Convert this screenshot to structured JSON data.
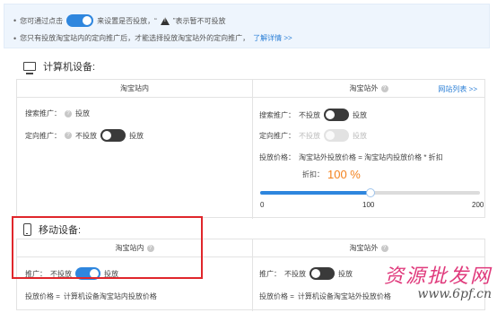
{
  "notice": {
    "line1_prefix": "您可通过点击",
    "line1_mid": "来设置是否投放，“",
    "line1_suffix": "”表示暂不可投放",
    "line2_text": "您只有投放淘宝站内的定向推广后，才能选择投放淘宝站外的定向推广，",
    "line2_link": "了解详情 >>",
    "bullet": "•"
  },
  "pc_section": {
    "title": "计算机设备:",
    "icon": "computer-icon",
    "left_header": "淘宝站内",
    "right_header": "淘宝站外",
    "right_link": "网站列表 >>",
    "left": {
      "search_label": "搜索推广：",
      "search_value": "投放",
      "target_label": "定向推广：",
      "target_off": "不投放",
      "target_on": "投放"
    },
    "right": {
      "search_label": "搜索推广：",
      "search_off": "不投放",
      "search_on": "投放",
      "target_label": "定向推广：",
      "target_off": "不投放",
      "target_on": "投放",
      "price_label": "投放价格：",
      "price_formula": "淘宝站外投放价格 = 淘宝站内投放价格 * 折扣",
      "discount_label": "折扣：",
      "discount_value": "100 %",
      "slider_min": "0",
      "slider_mid": "100",
      "slider_max": "200",
      "slider_value": 100
    }
  },
  "mobile_section": {
    "title": "移动设备:",
    "icon": "phone-icon",
    "left_header": "淘宝站内",
    "right_header": "淘宝站外",
    "left": {
      "promo_label": "推广：",
      "promo_off": "不投放",
      "promo_on": "投放",
      "price_label": "投放价格 =",
      "price_value": "计算机设备淘宝站内投放价格"
    },
    "right": {
      "promo_label": "推广：",
      "promo_off": "不投放",
      "promo_on": "投放",
      "price_label": "投放价格 =",
      "price_value": "计算机设备淘宝站外投放价格"
    }
  },
  "watermark": {
    "big": "资源批发网",
    "small": "www.6pf.cn"
  },
  "colors": {
    "accent": "#2e86de",
    "highlight": "#e0262b",
    "orange": "#f3821e"
  }
}
